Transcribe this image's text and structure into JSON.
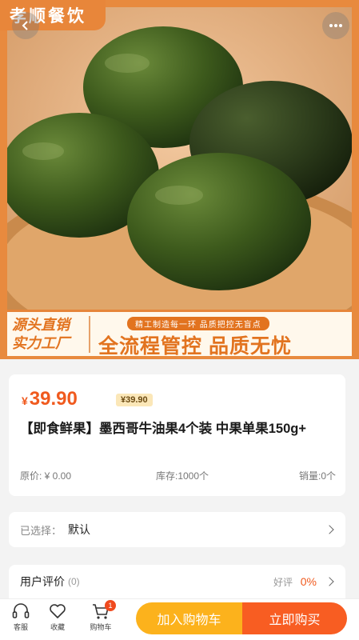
{
  "hero": {
    "brand_text": "孝顺餐饮",
    "banner_left_line1": "源头直销",
    "banner_left_line2": "实力工厂",
    "banner_sub": "精工制造每一环 品质把控无盲点",
    "banner_main": "全流程管控 品质无忧"
  },
  "product": {
    "price_symbol": "¥",
    "price": "39.90",
    "vip_price": "¥39.90",
    "title": "【即食鲜果】墨西哥牛油果4个装 中果单果150g+",
    "original_price": "原价: ¥ 0.00",
    "stock": "库存:1000个",
    "sold": "销量:0个"
  },
  "selection": {
    "label": "已选择：",
    "value": "默认"
  },
  "reviews": {
    "title": "用户评价",
    "count": "(0)",
    "good_label": "好评",
    "good_pct": "0%"
  },
  "bottom_bar": {
    "service": "客服",
    "favorite": "收藏",
    "cart": "购物车",
    "cart_count": "1",
    "add_to_cart": "加入购物车",
    "buy_now": "立即购买"
  },
  "colors": {
    "accent": "#f05a1e",
    "cart_button": "#fcb21c",
    "buy_button": "#f85d22",
    "brand_orange": "#e8863a"
  },
  "icons": [
    "back-arrow-icon",
    "more-dots-icon",
    "headset-icon",
    "heart-icon",
    "cart-icon",
    "chevron-right-icon"
  ]
}
